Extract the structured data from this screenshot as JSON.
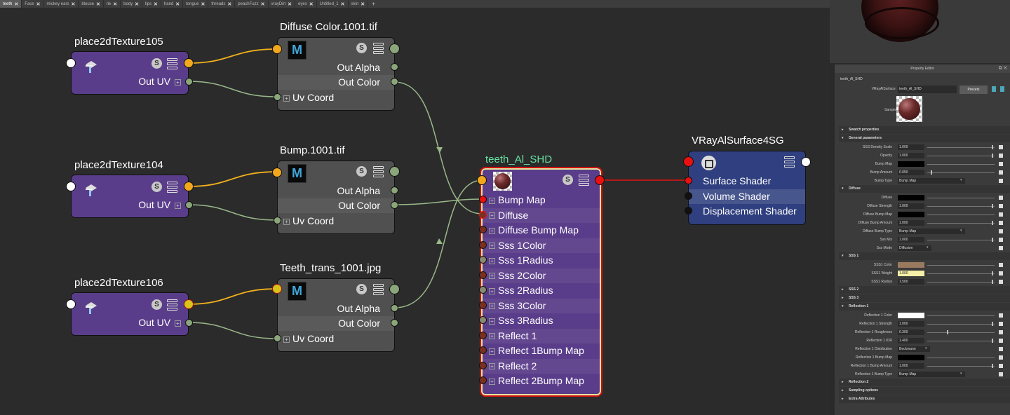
{
  "tabs": [
    "teeth",
    "Face",
    "mickey ears",
    "blouse",
    "tie",
    "body",
    "lips",
    "hand",
    "tongue",
    "threads",
    "peachFuzz",
    "vrayDirt",
    "eyes",
    "Untitled_1",
    "skin"
  ],
  "tab_add": "+",
  "nodes": {
    "place1": {
      "title": "place2dTexture105",
      "port": "Out UV"
    },
    "place2": {
      "title": "place2dTexture104",
      "port": "Out UV"
    },
    "place3": {
      "title": "place2dTexture106",
      "port": "Out UV"
    },
    "file1": {
      "title": "Diffuse Color.1001.tif",
      "out_alpha": "Out Alpha",
      "out_color": "Out Color",
      "uv": "Uv Coord"
    },
    "file2": {
      "title": "Bump.1001.tif",
      "out_alpha": "Out Alpha",
      "out_color": "Out Color",
      "uv": "Uv Coord"
    },
    "file3": {
      "title": "Teeth_trans_1001.jpg",
      "out_alpha": "Out Alpha",
      "out_color": "Out Color",
      "uv": "Uv Coord"
    },
    "shader": {
      "title": "teeth_Al_SHD",
      "attrs": [
        "Bump Map",
        "Diffuse",
        "Diffuse Bump Map",
        "Sss 1Color",
        "Sss 1Radius",
        "Sss 2Color",
        "Sss 2Radius",
        "Sss 3Color",
        "Sss 3Radius",
        "Reflect 1",
        "Reflect 1Bump Map",
        "Reflect 2",
        "Reflect 2Bump Map"
      ]
    },
    "sg": {
      "title": "VRayAlSurface4SG",
      "attrs": [
        "Surface Shader",
        "Volume Shader",
        "Displacement Shader"
      ]
    }
  },
  "icons": {
    "s_button": "S",
    "m_icon": "M"
  },
  "property_editor": {
    "title": "Property Editor",
    "node_name": "teeth_Al_SHD",
    "type_label": "VRayAlSurface:",
    "type_value": "teeth_Al_SHD",
    "presets": "Presets",
    "sample_label": "Sample",
    "sections": {
      "swatch": "Swatch properties",
      "general": "General parameters",
      "diffuse": "Diffuse",
      "sss1": "SSS 1",
      "sss2": "SSS 2",
      "sss3": "SSS 3",
      "refl1": "Reflection 1",
      "refl2": "Reflection 2",
      "sampling": "Sampling options",
      "extra": "Extra Attributes"
    },
    "general": [
      {
        "label": "SSS Density Scale",
        "value": "1.000"
      },
      {
        "label": "Opacity",
        "value": "1.000"
      },
      {
        "label": "Bump Map",
        "value": ""
      },
      {
        "label": "Bump Amount",
        "value": "0.050"
      },
      {
        "label": "Bump Type",
        "value": "Bump Map"
      }
    ],
    "diffuse": [
      {
        "label": "Diffuse",
        "value": ""
      },
      {
        "label": "Diffuse Strength",
        "value": "1.000"
      },
      {
        "label": "Diffuse Bump Map",
        "value": ""
      },
      {
        "label": "Diffuse Bump Amount",
        "value": "1.000"
      },
      {
        "label": "Diffuse Bump Type",
        "value": "Bump Map"
      },
      {
        "label": "Sss Mix",
        "value": "1.000"
      },
      {
        "label": "Sss Mode",
        "value": "Diffusion"
      }
    ],
    "sss1": [
      {
        "label": "SSS1 Color",
        "value": ""
      },
      {
        "label": "SSS1 Weight",
        "value": "1.000"
      },
      {
        "label": "SSS1 Radius",
        "value": "1.500"
      }
    ],
    "refl1": [
      {
        "label": "Reflection 1 Color",
        "value": ""
      },
      {
        "label": "Reflection 1 Strength",
        "value": "1.000"
      },
      {
        "label": "Reflection 1 Roughness",
        "value": "0.300"
      },
      {
        "label": "Reflection 1 IOR",
        "value": "1.400"
      },
      {
        "label": "Reflection 1 Distribution",
        "value": "Beckmann"
      },
      {
        "label": "Reflection 1 Bump Map",
        "value": ""
      },
      {
        "label": "Reflection 1 Bump Amount",
        "value": "1.000"
      },
      {
        "label": "Reflection 1 Bump Type",
        "value": "Bump Map"
      }
    ]
  },
  "colors": {
    "port_orange": "#f2a81d",
    "port_green": "#8aa67a",
    "port_red": "#e81010",
    "port_brown": "#7a3020",
    "wire_yellow": "#f2b01d",
    "wire_green": "#9ab88a",
    "wire_red": "#e81010",
    "shader_selected": "#66e0a0"
  }
}
